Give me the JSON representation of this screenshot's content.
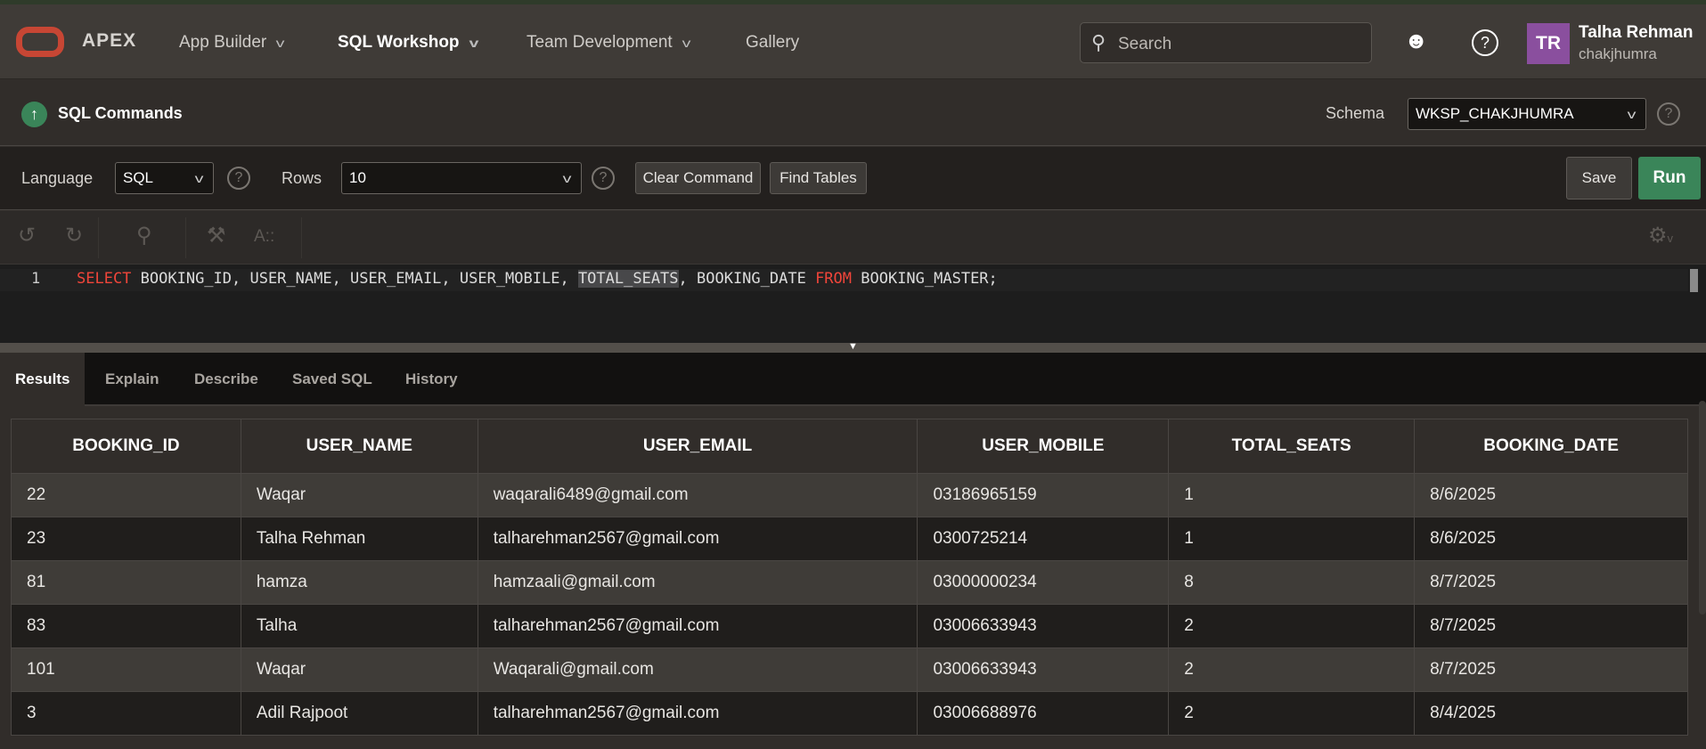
{
  "header": {
    "app": "APEX",
    "nav": [
      {
        "label": "App Builder"
      },
      {
        "label": "SQL Workshop"
      },
      {
        "label": "Team Development"
      },
      {
        "label": "Gallery"
      }
    ],
    "search_placeholder": "Search",
    "user_initials": "TR",
    "user_name": "Talha Rehman",
    "workspace": "chakjhumra"
  },
  "page": {
    "title": "SQL Commands",
    "schema_label": "Schema",
    "schema_value": "WKSP_CHAKJHUMRA"
  },
  "toolbar": {
    "language_label": "Language",
    "language_value": "SQL",
    "rows_label": "Rows",
    "rows_value": "10",
    "clear": "Clear Command",
    "find": "Find Tables",
    "save": "Save",
    "run": "Run"
  },
  "editor": {
    "line_number": "1",
    "kw_select": "SELECT",
    "cols1": " BOOKING_ID, USER_NAME, USER_EMAIL, USER_MOBILE, ",
    "highlight": "TOTAL_SEATS",
    "cols2": ", BOOKING_DATE ",
    "kw_from": "FROM",
    "rest": " BOOKING_MASTER;"
  },
  "tabs": [
    {
      "label": "Results"
    },
    {
      "label": "Explain"
    },
    {
      "label": "Describe"
    },
    {
      "label": "Saved SQL"
    },
    {
      "label": "History"
    }
  ],
  "results": {
    "columns": [
      "BOOKING_ID",
      "USER_NAME",
      "USER_EMAIL",
      "USER_MOBILE",
      "TOTAL_SEATS",
      "BOOKING_DATE"
    ],
    "rows": [
      [
        "22",
        "Waqar",
        "waqarali6489@gmail.com",
        "03186965159",
        "1",
        "8/6/2025"
      ],
      [
        "23",
        "Talha Rehman",
        "talharehman2567@gmail.com",
        "0300725214",
        "1",
        "8/6/2025"
      ],
      [
        "81",
        "hamza",
        "hamzaali@gmail.com",
        "03000000234",
        "8",
        "8/7/2025"
      ],
      [
        "83",
        "Talha",
        "talharehman2567@gmail.com",
        "03006633943",
        "2",
        "8/7/2025"
      ],
      [
        "101",
        "Waqar",
        "Waqarali@gmail.com",
        "03006633943",
        "2",
        "8/7/2025"
      ],
      [
        "3",
        "Adil Rajpoot",
        "talharehman2567@gmail.com",
        "03006688976",
        "2",
        "8/4/2025"
      ]
    ]
  }
}
